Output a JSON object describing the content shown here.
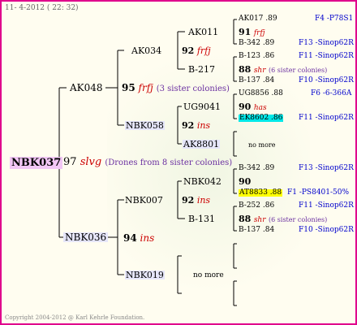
{
  "header": "11-  4-2012 ( 22: 32)",
  "footer": "Copyright 2004-2012 @ Karl Kehrle Foundation.",
  "root": {
    "name": "NBK037",
    "score": "97",
    "breeder": "slvg",
    "note": "(Drones from 8 sister colonies)"
  },
  "gen1": {
    "father": {
      "name": "AK048",
      "score": "95",
      "breeder": "frfj",
      "note": "(3 sister colonies)"
    },
    "mother": {
      "name": "NBK036",
      "score": "94",
      "breeder": "ins"
    }
  },
  "gen2": {
    "ff": {
      "name": "AK034",
      "score": "92",
      "breeder": "frfj"
    },
    "fm": {
      "name": "NBK058",
      "score": "92",
      "breeder": "ins"
    },
    "mf": {
      "name": "NBK007",
      "score": "92",
      "breeder": "ins"
    },
    "mm": {
      "name": "NBK019",
      "note": "no more"
    }
  },
  "gen3": {
    "fff": "AK011",
    "ffm": "B-217",
    "fmf": "UG9041",
    "fmm": "AK8801",
    "mff": "NBK042",
    "mfm": "B-131",
    "mmn": "no more"
  },
  "gen4": {
    "r1": {
      "name": "AK017 .89",
      "origin": "F4 -P78S1"
    },
    "r2": {
      "score": "91",
      "breeder": "frfj"
    },
    "r3": {
      "name": "B-342 .89",
      "origin": "F13 -Sinop62R"
    },
    "r4": {
      "name": "B-123 .86",
      "origin": "F11 -Sinop62R"
    },
    "r5": {
      "score": "88",
      "breeder": "shr",
      "note": "(6 sister colonies)"
    },
    "r6": {
      "name": "B-137 .84",
      "origin": "F10 -Sinop62R"
    },
    "r7": {
      "name": "UG8856 .88",
      "origin": "F6 -6-366A"
    },
    "r8": {
      "score": "90",
      "breeder": "has"
    },
    "r9": {
      "name": "EK8602 .86",
      "origin": "F11 -Sinop62R"
    },
    "r10": {
      "note": "no more"
    },
    "r11": {
      "name": "B-342 .89",
      "origin": "F13 -Sinop62R"
    },
    "r12": {
      "score": "90"
    },
    "r13": {
      "name": "AT8833 .88",
      "origin": "F1 -PS8401-50%"
    },
    "r14": {
      "name": "B-252 .86",
      "origin": "F11 -Sinop62R"
    },
    "r15": {
      "score": "88",
      "breeder": "shr",
      "note": "(6 sister colonies)"
    },
    "r16": {
      "name": "B-137 .84",
      "origin": "F10 -Sinop62R"
    }
  }
}
